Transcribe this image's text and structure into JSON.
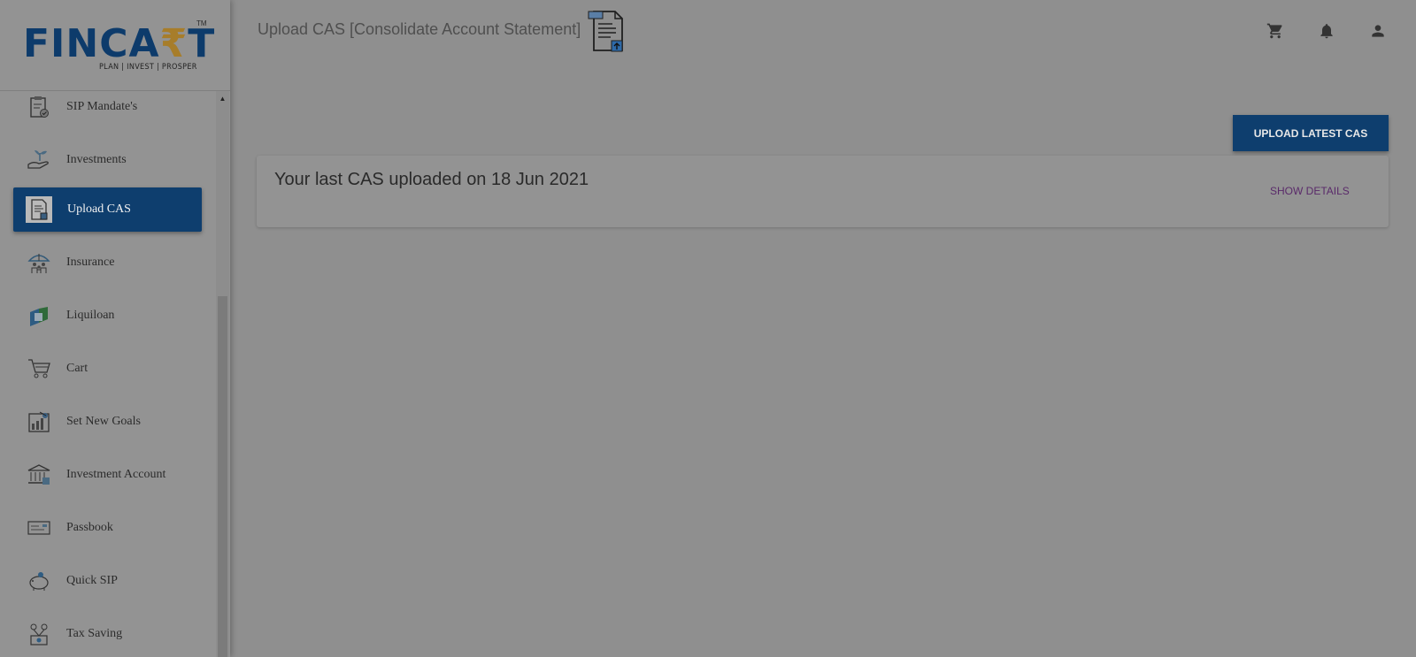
{
  "brand": {
    "logo_text_part1": "FINCA",
    "logo_text_rupee": "₹",
    "logo_text_part2": "T",
    "logo_tm": "TM",
    "tagline": "PLAN | INVEST | PROSPER",
    "colors": {
      "primary": "#0e3e6e",
      "accent": "#a77d2a"
    }
  },
  "sidebar": {
    "items": [
      {
        "label": "SIP Mandate's",
        "icon": "clipboard-check-icon"
      },
      {
        "label": "Investments",
        "icon": "hand-plant-icon"
      },
      {
        "label": "Upload CAS",
        "icon": "document-upload-icon",
        "active": true
      },
      {
        "label": "Insurance",
        "icon": "umbrella-family-icon"
      },
      {
        "label": "Liquiloan",
        "icon": "liquiloan-logo-icon"
      },
      {
        "label": "Cart",
        "icon": "cart-icon"
      },
      {
        "label": "Set New Goals",
        "icon": "goals-chart-icon"
      },
      {
        "label": "Investment Account",
        "icon": "bank-icon"
      },
      {
        "label": "Passbook",
        "icon": "passbook-icon"
      },
      {
        "label": "Quick SIP",
        "icon": "piggy-bank-icon"
      },
      {
        "label": "Tax Saving",
        "icon": "tax-saving-icon"
      }
    ]
  },
  "header": {
    "title": "Upload CAS [Consolidate Account Statement]",
    "icons": [
      "cart-icon",
      "bell-icon",
      "user-icon"
    ]
  },
  "main": {
    "upload_button": "UPLOAD LATEST CAS",
    "cas_status": "Your last CAS uploaded on 18 Jun 2021",
    "show_details": "SHOW DETAILS"
  }
}
